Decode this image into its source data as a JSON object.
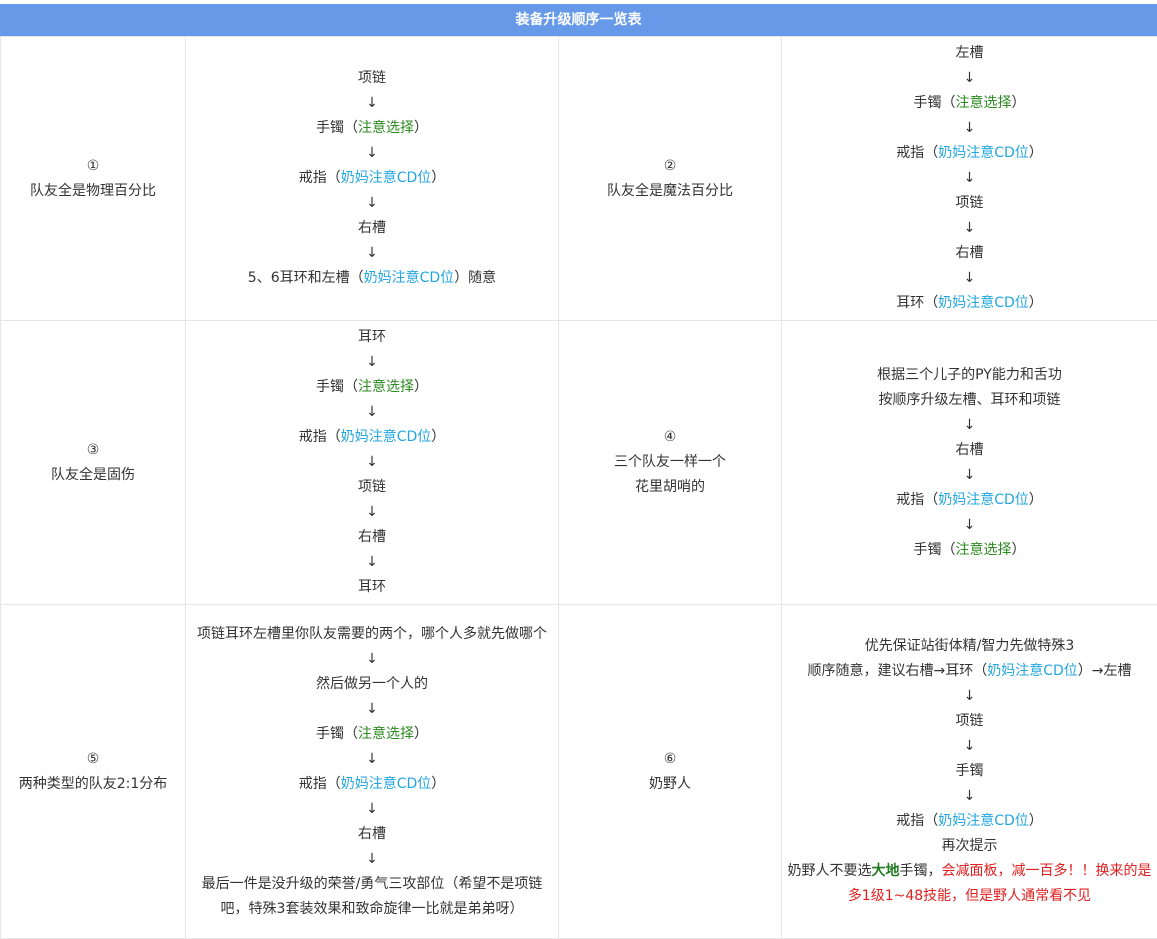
{
  "title": "装备升级顺序一览表",
  "arrow": "↓",
  "rows": [
    {
      "cells": [
        {
          "num": "①",
          "label": "队友全是物理百分比"
        },
        {
          "l1": "项链",
          "l2a": "手镯（",
          "l2b": "注意选择",
          "l2c": "）",
          "l3a": "戒指（",
          "l3b": "奶妈注意CD位",
          "l3c": "）",
          "l4": "右槽",
          "l5a": "5、6耳环和左槽（",
          "l5b": "奶妈注意CD位",
          "l5c": "）随意"
        },
        {
          "num": "②",
          "label": "队友全是魔法百分比"
        },
        {
          "l1": "左槽",
          "l2a": "手镯（",
          "l2b": "注意选择",
          "l2c": "）",
          "l3a": "戒指（",
          "l3b": "奶妈注意CD位",
          "l3c": "）",
          "l4": "项链",
          "l5": "右槽",
          "l6a": "耳环（",
          "l6b": "奶妈注意CD位",
          "l6c": "）"
        }
      ]
    },
    {
      "cells": [
        {
          "num": "③",
          "label": "队友全是固伤"
        },
        {
          "l1": "耳环",
          "l2a": "手镯（",
          "l2b": "注意选择",
          "l2c": "）",
          "l3a": "戒指（",
          "l3b": "奶妈注意CD位",
          "l3c": "）",
          "l4": "项链",
          "l5": "右槽",
          "l6": "耳环"
        },
        {
          "num": "④",
          "label1": "三个队友一样一个",
          "label2": "花里胡哨的"
        },
        {
          "l1": "根据三个儿子的PY能力和舌功",
          "l2": "按顺序升级左槽、耳环和项链",
          "l3": "右槽",
          "l4a": "戒指（",
          "l4b": "奶妈注意CD位",
          "l4c": "）",
          "l5a": "手镯（",
          "l5b": "注意选择",
          "l5c": "）"
        }
      ]
    },
    {
      "cells": [
        {
          "num": "⑤",
          "label": "两种类型的队友2:1分布"
        },
        {
          "l1": "项链耳环左槽里你队友需要的两个，哪个人多就先做哪个",
          "l2": "然后做另一个人的",
          "l3a": "手镯（",
          "l3b": "注意选择",
          "l3c": "）",
          "l4a": "戒指（",
          "l4b": "奶妈注意CD位",
          "l4c": "）",
          "l5": "右槽",
          "l6": "最后一件是没升级的荣誉/勇气三攻部位（希望不是项链吧，特殊3套装效果和致命旋律一比就是弟弟呀）"
        },
        {
          "num": "⑥",
          "label": "奶野人"
        },
        {
          "l1": "优先保证站街体精/智力先做特殊3",
          "l2a": "顺序随意，建议右槽→耳环（",
          "l2b": "奶妈注意CD位",
          "l2c": "）→左槽",
          "l3": "项链",
          "l4": "手镯",
          "l5a": "戒指（",
          "l5b": "奶妈注意CD位",
          "l5c": "）",
          "l6": "再次提示",
          "l7a": "奶野人不要选",
          "l7b": "大地",
          "l7c": "手镯，",
          "l7d": "会减面板，减一百多！！换来的是多1级1~48技能，但是野人通常看不见"
        }
      ]
    }
  ],
  "colors": {
    "header_bg": "#6699e8",
    "green": "#2e8b22",
    "blue": "#22a6e0",
    "red": "#e02020",
    "border": "#e6e6e6"
  }
}
